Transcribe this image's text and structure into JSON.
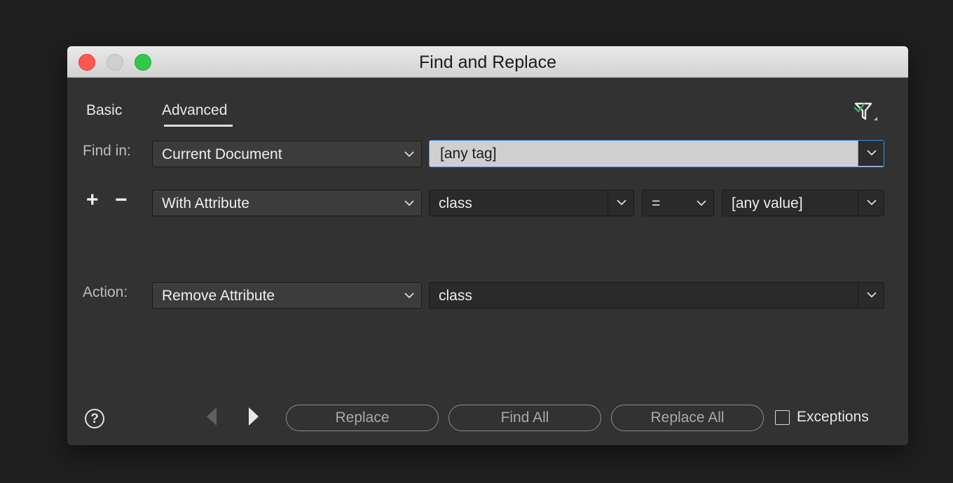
{
  "window": {
    "title": "Find and Replace"
  },
  "tabs": [
    {
      "label": "Basic",
      "selected": false
    },
    {
      "label": "Advanced",
      "selected": true
    }
  ],
  "find_in": {
    "label": "Find in:",
    "scope": "Current Document",
    "tag": "[any tag]"
  },
  "condition": {
    "add_symbol": "+",
    "remove_symbol": "−",
    "type": "With Attribute",
    "attribute": "class",
    "operator": "=",
    "value": "[any value]"
  },
  "action": {
    "label": "Action:",
    "type": "Remove Attribute",
    "attribute": "class"
  },
  "footer": {
    "help_symbol": "?",
    "replace_label": "Replace",
    "find_all_label": "Find All",
    "replace_all_label": "Replace All",
    "exceptions_label": "Exceptions",
    "exceptions_checked": false
  },
  "icons": {
    "close": "close-icon",
    "minimize": "minimize-icon",
    "zoom": "zoom-icon",
    "filter": "filter-check-icon",
    "previous": "triangle-left-icon",
    "next": "triangle-right-icon",
    "help": "help-icon"
  },
  "colors": {
    "background": "#1f1f1f",
    "panel": "#323232",
    "focus_ring": "#3f8ee6",
    "close": "#fc5753",
    "zoom": "#33c748",
    "check_accent": "#3fae5a"
  }
}
